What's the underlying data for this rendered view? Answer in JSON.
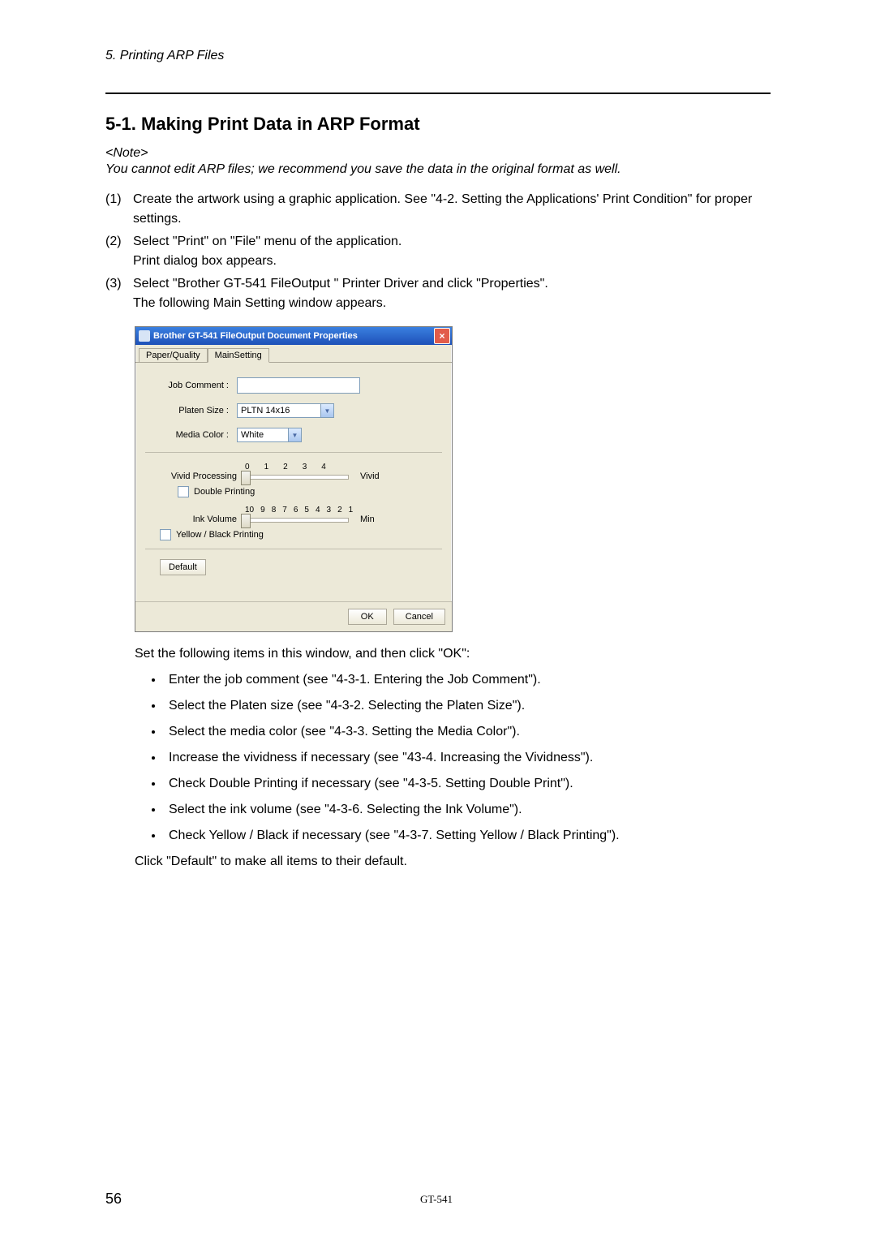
{
  "chapter_header": "5. Printing ARP Files",
  "section_title": "5-1. Making Print Data in ARP Format",
  "note_heading": "<Note>",
  "note_body": "You cannot edit ARP files; we recommend you save the data in the original format as well.",
  "steps": [
    {
      "num": "(1)",
      "text": "Create the artwork using a graphic application. See \"4-2. Setting the Applications' Print Condition\" for proper settings."
    },
    {
      "num": "(2)",
      "text": "Select \"Print\" on \"File\" menu of the application.\nPrint dialog box appears."
    },
    {
      "num": "(3)",
      "text": "Select \"Brother GT-541 FileOutput \" Printer Driver and click \"Properties\".\nThe following Main Setting window appears."
    }
  ],
  "dialog": {
    "title": "Brother GT-541 FileOutput Document Properties",
    "tabs": {
      "inactive": "Paper/Quality",
      "active": "MainSetting"
    },
    "labels": {
      "job_comment": "Job Comment :",
      "platen_size": "Platen Size :",
      "media_color": "Media Color :",
      "vivid_processing": "Vivid Processing",
      "double_printing": "Double Printing",
      "ink_volume": "Ink Volume",
      "yellow_black": "Yellow / Black Printing",
      "default_btn": "Default",
      "ok_btn": "OK",
      "cancel_btn": "Cancel"
    },
    "values": {
      "platen_size": "PLTN 14x16",
      "media_color": "White"
    },
    "vivid_ticks": [
      "0",
      "1",
      "2",
      "3",
      "4"
    ],
    "vivid_suffix": "Vivid",
    "ink_ticks": [
      "10",
      "9",
      "8",
      "7",
      "6",
      "5",
      "4",
      "3",
      "2",
      "1"
    ],
    "ink_suffix": "Min"
  },
  "after_dialog": "Set the following items in this window, and then click \"OK\":",
  "bullets": [
    "Enter the job comment (see \"4-3-1. Entering the Job Comment\").",
    "Select the Platen size (see \"4-3-2. Selecting the Platen Size\").",
    "Select the media color (see \"4-3-3. Setting the Media Color\").",
    "Increase the vividness if necessary (see \"43-4. Increasing the Vividness\").",
    "Check Double Printing if necessary (see \"4-3-5. Setting Double Print\").",
    "Select the ink volume (see \"4-3-6. Selecting the Ink Volume\").",
    "Check Yellow / Black if necessary (see \"4-3-7. Setting Yellow / Black Printing\")."
  ],
  "after_bullets": "Click \"Default\" to make all items to their default.",
  "footer": {
    "page": "56",
    "model": "GT-541"
  }
}
